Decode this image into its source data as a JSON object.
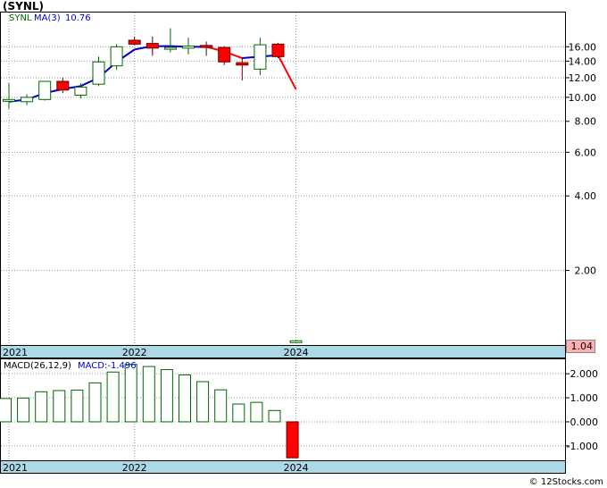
{
  "title": "(SYNL)",
  "watermark": "© 12Stocks.com",
  "colors": {
    "up_fill": "#ffffff",
    "up_stroke": "#006600",
    "down_fill": "#ff0000",
    "down_stroke": "#660000",
    "ma_blue": "#0000cc",
    "ma_red": "#ff0000",
    "grid": "#999999",
    "axis_band": "#add8e6",
    "last_price_bg": "#ffb0b0"
  },
  "price_chart": {
    "legend": {
      "symbol": "SYNL",
      "ma_label": "MA(3)",
      "ma_value": "10.76"
    },
    "scale": "log",
    "ylim": [
      1.0,
      22.0
    ],
    "y_ticks": [
      {
        "value": 16,
        "label": "16.00"
      },
      {
        "value": 14,
        "label": "14.00"
      },
      {
        "value": 12,
        "label": "12.00"
      },
      {
        "value": 10,
        "label": "10.00"
      },
      {
        "value": 8,
        "label": "8.00"
      },
      {
        "value": 6,
        "label": "6.00"
      },
      {
        "value": 4,
        "label": "4.00"
      },
      {
        "value": 2,
        "label": "2.00"
      }
    ],
    "last_price_label": "1.04",
    "x_labels": [
      "2021",
      "2022",
      "2024"
    ]
  },
  "macd_chart": {
    "legend": {
      "label": "MACD(26,12,9)",
      "value_label": "MACD:-1.496"
    },
    "ylim": [
      -1.6,
      2.6
    ],
    "y_ticks": [
      {
        "value": 2,
        "label": "2.000"
      },
      {
        "value": 1,
        "label": "1.000"
      },
      {
        "value": 0,
        "label": "0.000"
      },
      {
        "value": -1,
        "label": "-1.000"
      }
    ],
    "x_labels": [
      "2021",
      "2022",
      "2024"
    ]
  },
  "chart_data": [
    {
      "type": "candlestick",
      "title": "(SYNL)",
      "series_name": "SYNL",
      "scale": "log",
      "candles": [
        {
          "open": 9.8,
          "high": 11.4,
          "low": 9.0,
          "close": 9.8
        },
        {
          "open": 9.6,
          "high": 10.3,
          "low": 9.3,
          "close": 10.0
        },
        {
          "open": 9.8,
          "high": 11.6,
          "low": 9.7,
          "close": 11.6
        },
        {
          "open": 11.6,
          "high": 12.0,
          "low": 10.4,
          "close": 10.7
        },
        {
          "open": 10.2,
          "high": 11.4,
          "low": 9.9,
          "close": 11.0
        },
        {
          "open": 11.3,
          "high": 14.6,
          "low": 11.1,
          "close": 13.9
        },
        {
          "open": 13.4,
          "high": 16.4,
          "low": 12.9,
          "close": 16.0
        },
        {
          "open": 17.0,
          "high": 17.6,
          "low": 16.2,
          "close": 16.4
        },
        {
          "open": 16.5,
          "high": 17.6,
          "low": 14.7,
          "close": 15.8
        },
        {
          "open": 15.8,
          "high": 19.0,
          "low": 15.2,
          "close": 15.9
        },
        {
          "open": 15.8,
          "high": 17.4,
          "low": 14.9,
          "close": 16.1
        },
        {
          "open": 16.2,
          "high": 16.8,
          "low": 14.7,
          "close": 15.9
        },
        {
          "open": 15.9,
          "high": 16.1,
          "low": 13.5,
          "close": 13.9
        },
        {
          "open": 13.8,
          "high": 14.5,
          "low": 11.7,
          "close": 13.5
        },
        {
          "open": 13.0,
          "high": 17.4,
          "low": 12.3,
          "close": 16.3
        },
        {
          "open": 16.4,
          "high": 16.6,
          "low": 14.4,
          "close": 14.6
        },
        {
          "open": 1.04,
          "high": 1.05,
          "low": 1.02,
          "close": 1.04
        }
      ],
      "ma3": [
        9.6,
        9.8,
        10.4,
        10.8,
        11.1,
        12.0,
        13.9,
        15.6,
        16.1,
        16.1,
        16.0,
        16.0,
        15.3,
        14.4,
        14.6,
        14.8,
        10.76
      ],
      "x_tick_labels": [
        "2021",
        "2022",
        "2024"
      ]
    },
    {
      "type": "bar",
      "title": "MACD(26,12,9)",
      "values": [
        0.97,
        0.99,
        1.25,
        1.3,
        1.32,
        1.62,
        2.07,
        2.39,
        2.3,
        2.17,
        1.95,
        1.67,
        1.33,
        0.74,
        0.81,
        0.47,
        -1.496
      ],
      "x_tick_labels": [
        "2021",
        "2022",
        "2024"
      ]
    }
  ]
}
